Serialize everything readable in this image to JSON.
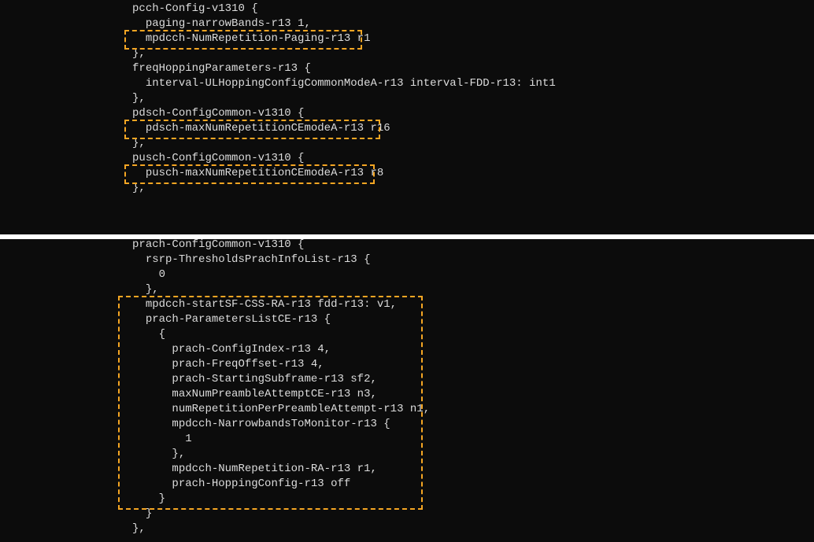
{
  "code_top": {
    "lines": [
      "                    pcch-Config-v1310 {",
      "                      paging-narrowBands-r13 1,",
      "                      mpdcch-NumRepetition-Paging-r13 r1",
      "                    },",
      "                    freqHoppingParameters-r13 {",
      "                      interval-ULHoppingConfigCommonModeA-r13 interval-FDD-r13: int1",
      "                    },",
      "                    pdsch-ConfigCommon-v1310 {",
      "                      pdsch-maxNumRepetitionCEmodeA-r13 r16",
      "                    },",
      "                    pusch-ConfigCommon-v1310 {",
      "                      pusch-maxNumRepetitionCEmodeA-r13 r8",
      "                    },"
    ]
  },
  "code_bottom": {
    "lines": [
      "                    prach-ConfigCommon-v1310 {",
      "                      rsrp-ThresholdsPrachInfoList-r13 {",
      "                        0",
      "                      },",
      "                      mpdcch-startSF-CSS-RA-r13 fdd-r13: v1,",
      "                      prach-ParametersListCE-r13 {",
      "                        {",
      "                          prach-ConfigIndex-r13 4,",
      "                          prach-FreqOffset-r13 4,",
      "                          prach-StartingSubframe-r13 sf2,",
      "                          maxNumPreambleAttemptCE-r13 n3,",
      "                          numRepetitionPerPreambleAttempt-r13 n1,",
      "                          mpdcch-NarrowbandsToMonitor-r13 {",
      "                            1",
      "                          },",
      "                          mpdcch-NumRepetition-RA-r13 r1,",
      "                          prach-HoppingConfig-r13 off",
      "                        }",
      "                      }",
      "                    },"
    ]
  },
  "highlights_top": [
    {
      "line": 2,
      "col_start": 21,
      "col_end": 58
    },
    {
      "line": 8,
      "col_start": 21,
      "col_end": 61
    },
    {
      "line": 11,
      "col_start": 21,
      "col_end": 60
    }
  ],
  "highlights_bottom": [
    {
      "line_start": 4,
      "line_end": 17,
      "col_start": 20,
      "col_end": 68
    }
  ],
  "colors": {
    "bg": "#0c0c0c",
    "fg": "#dcdcdc",
    "highlight": "#f5a623"
  }
}
